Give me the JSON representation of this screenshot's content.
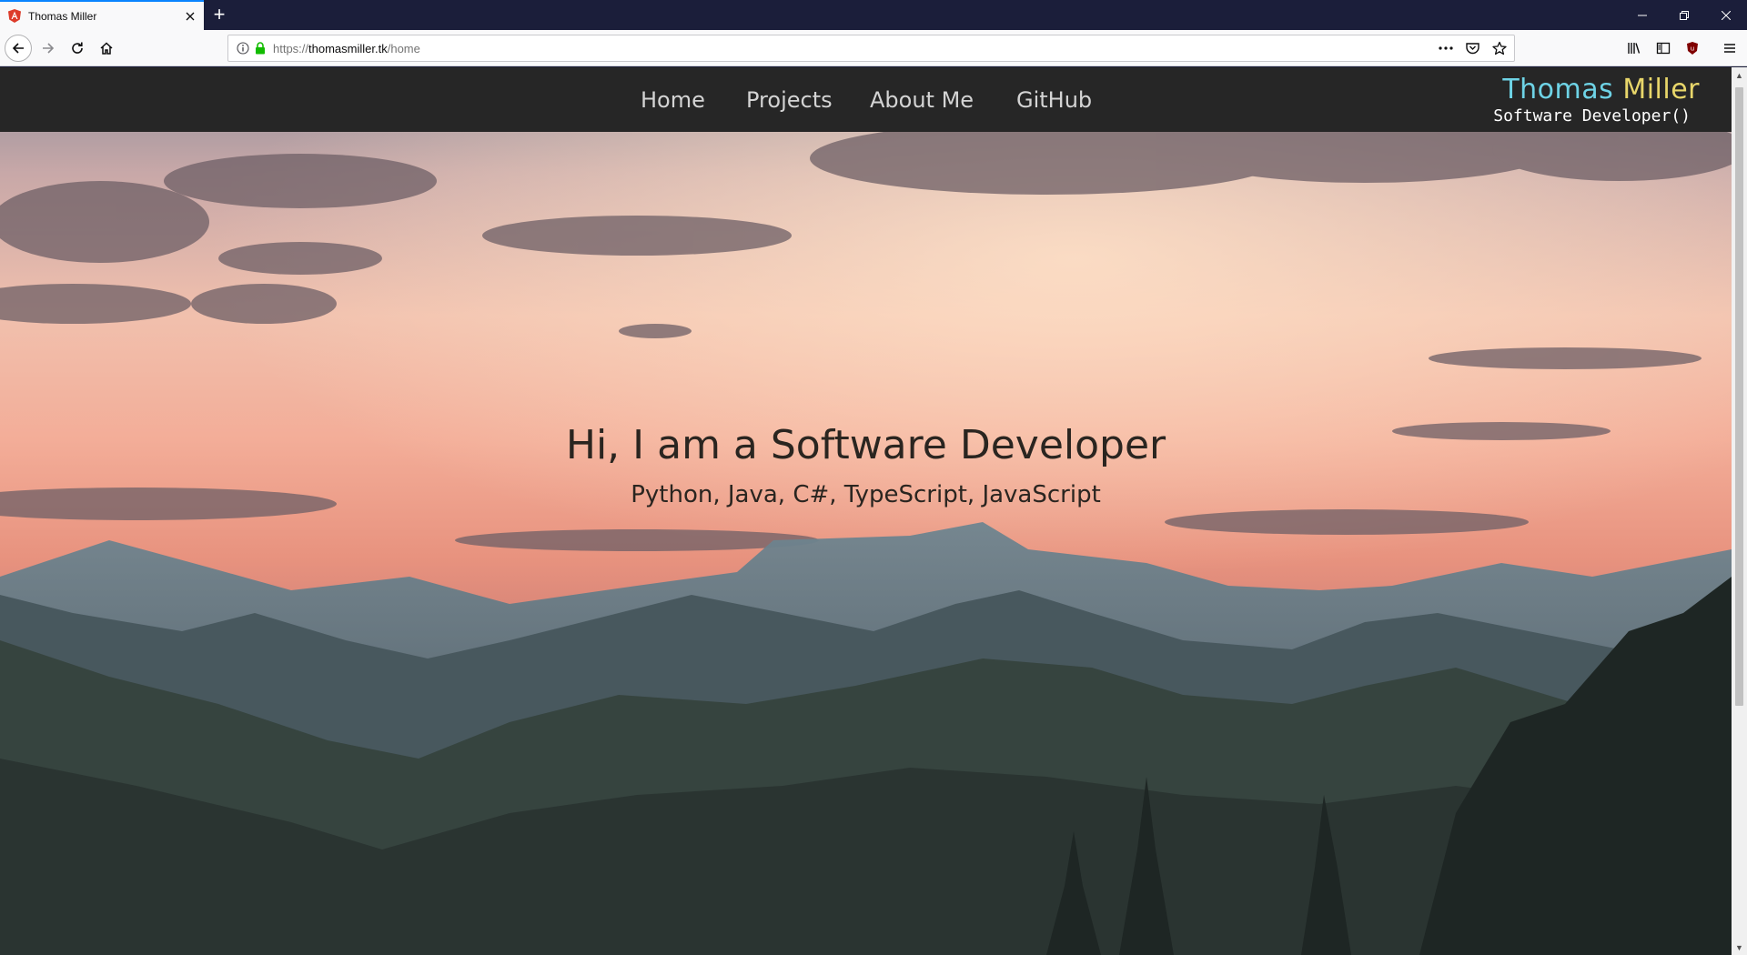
{
  "browser": {
    "tab": {
      "title": "Thomas Miller",
      "close_icon": "close-icon",
      "favicon_icon": "angular-shield-icon"
    },
    "new_tab_label": "+",
    "url": {
      "prefix": "https://",
      "host": "thomasmiller.tk",
      "path": "/home"
    },
    "toolbar_icons": [
      "back-arrow-icon",
      "forward-arrow-icon",
      "reload-icon",
      "home-icon",
      "info-icon",
      "lock-icon",
      "more-dots-icon",
      "pocket-icon",
      "bookmark-star-icon",
      "library-icon",
      "sidebar-icon",
      "ublock-icon",
      "menu-icon"
    ]
  },
  "site": {
    "nav": [
      "Home",
      "Projects",
      "About Me",
      "GitHub"
    ],
    "brand": {
      "first": "Thomas",
      "last": "Miller",
      "tagline": "Software Developer()"
    }
  },
  "hero": {
    "title": "Hi, I am a Software Developer",
    "subtitle": "Python, Java, C#, TypeScript, JavaScript"
  },
  "colors": {
    "nav_bg": "#262626",
    "brand_first": "#6ed3e6",
    "brand_last": "#e8d66a",
    "tab_accent": "#0a84ff",
    "titlebar": "#1b1e3a"
  }
}
